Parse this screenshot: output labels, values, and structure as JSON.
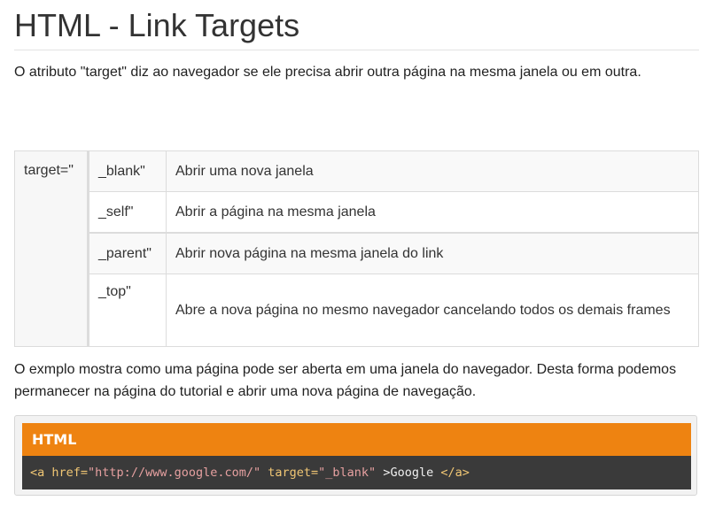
{
  "page": {
    "title": "HTML - Link Targets",
    "intro": "O atributo \"target\" diz ao navegador se ele precisa abrir outra página na mesma janela ou em outra."
  },
  "table": {
    "target_label": "target=\"",
    "rows": [
      {
        "value": "_blank\"",
        "description": "Abrir uma nova janela"
      },
      {
        "value": "_self\"",
        "description": "Abrir a página na mesma janela"
      },
      {
        "value": "_parent\"",
        "description": "Abrir nova página na mesma janela do link"
      },
      {
        "value": "_top\"",
        "description": "Abre a nova página no mesmo navegador cancelando todos os demais frames"
      }
    ]
  },
  "example": {
    "text": "O exmplo mostra como uma página pode ser aberta em uma janela do navegador. Desta forma podemos permanecer na página do tutorial e abrir uma nova página de navegação."
  },
  "code": {
    "header": "HTML",
    "tokens": {
      "open_tag": "<a",
      "attr_href": " href=",
      "href_value": "\"http://www.google.com/\"",
      "attr_target": " target=",
      "target_value": "\"_blank\"",
      "close_open": " >",
      "link_text": "Google",
      "close_tag": " </a>"
    }
  }
}
